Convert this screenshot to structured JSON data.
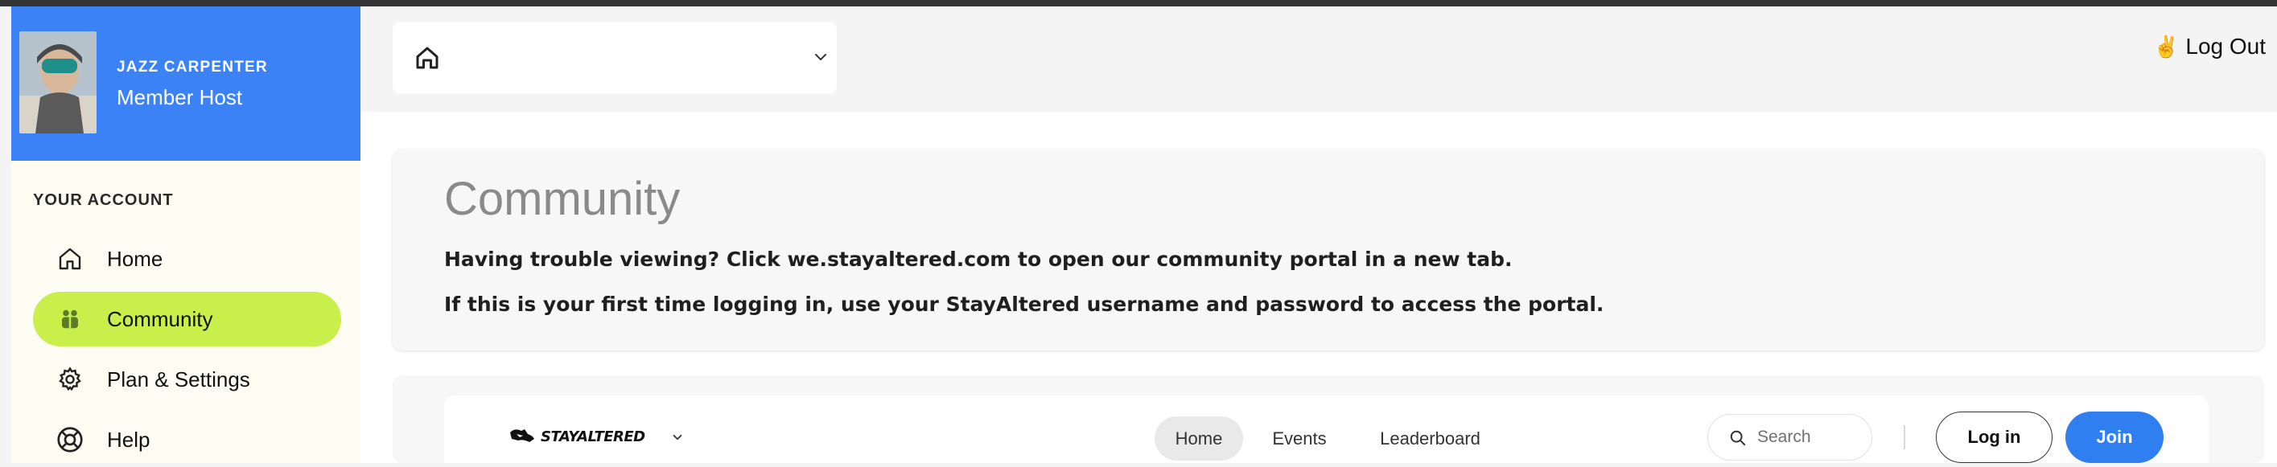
{
  "user": {
    "name": "JAZZ CARPENTER",
    "role": "Member Host"
  },
  "sidebar": {
    "section_label": "YOUR ACCOUNT",
    "items": [
      {
        "label": "Home",
        "icon": "home-icon"
      },
      {
        "label": "Community",
        "icon": "community-icon",
        "active": true
      },
      {
        "label": "Plan & Settings",
        "icon": "gear-icon"
      },
      {
        "label": "Help",
        "icon": "lifebuoy-icon"
      }
    ]
  },
  "header": {
    "selector_icon": "home-icon",
    "logout_label": "Log Out",
    "logout_emoji": "✌️"
  },
  "main": {
    "title": "Community",
    "line1": "Having trouble viewing? Click we.stayaltered.com to open our community portal in a new tab.",
    "line2": "If this is your first time logging in, use your StayAltered username and password to access the portal."
  },
  "portal": {
    "brand": "STAYALTERED",
    "nav": [
      "Home",
      "Events",
      "Leaderboard"
    ],
    "search_label": "Search",
    "login_label": "Log in",
    "join_label": "Join"
  },
  "colors": {
    "profile_bg": "#3b82f6",
    "active_nav": "#c9ef4b",
    "join_button": "#2f7ff0"
  }
}
